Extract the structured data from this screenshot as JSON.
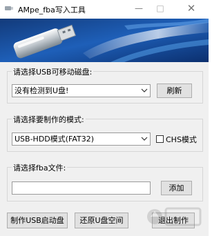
{
  "window": {
    "title": "AMpe_fba写入工具",
    "controls": {
      "minimize": "—",
      "maximize": "□",
      "close": "✕"
    }
  },
  "usb_group": {
    "label": "请选择USB可移动磁盘:",
    "selected": "没有检测到U盘!",
    "refresh_label": "刷新"
  },
  "mode_group": {
    "label": "请选择要制作的模式:",
    "selected": "USB-HDD模式(FAT32)",
    "chs_label": "CHS模式",
    "chs_checked": false
  },
  "fba_group": {
    "label": "请选择fba文件:",
    "file_value": "",
    "add_label": "添加"
  },
  "actions": {
    "make_label": "制作USB启动盘",
    "restore_label": "还原U盘空间",
    "exit_label": "退出制作"
  },
  "colors": {
    "banner_dark": "#0b2f6e",
    "banner_light": "#3f8fe0",
    "face": "#f0f0f0",
    "button": "#e1e1e1"
  }
}
